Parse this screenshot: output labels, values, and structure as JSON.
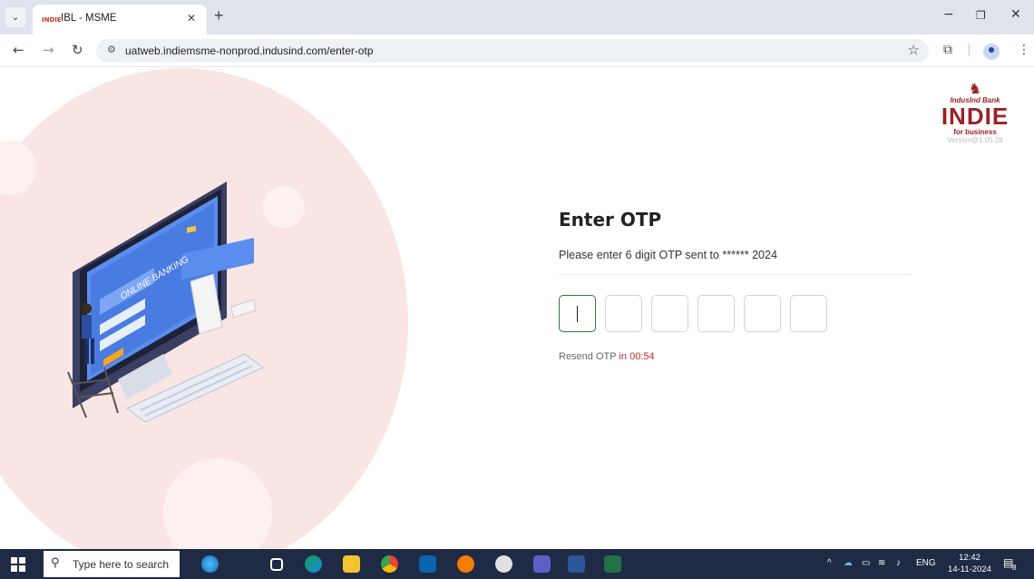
{
  "browser": {
    "tab_title": "IBL - MSME",
    "tab_favicon_text": "INDIE",
    "url": "uatweb.indiemsme-nonprod.indusind.com/enter-otp"
  },
  "logo": {
    "bank_name": "IndusInd Bank",
    "brand": "INDIE",
    "tagline": "for business",
    "version": "Version@1.05.28"
  },
  "otp": {
    "title": "Enter OTP",
    "description": "Please enter 6 digit OTP sent to ****** 2024",
    "digits": [
      "",
      "",
      "",
      "",
      "",
      ""
    ],
    "resend_label": "Resend OTP",
    "resend_timer": "in 00:54"
  },
  "illustration": {
    "screen_text": "ONLINE BANKING"
  },
  "taskbar": {
    "search_placeholder": "Type here to search",
    "language": "ENG",
    "time": "12:42",
    "date": "14-11-2024",
    "notification_count": "8"
  },
  "colors": {
    "brand": "#9b2226",
    "active_border": "#2e7d32",
    "timer": "#c62828",
    "blob": "#f9e6e4",
    "taskbar": "#1f2a44"
  }
}
